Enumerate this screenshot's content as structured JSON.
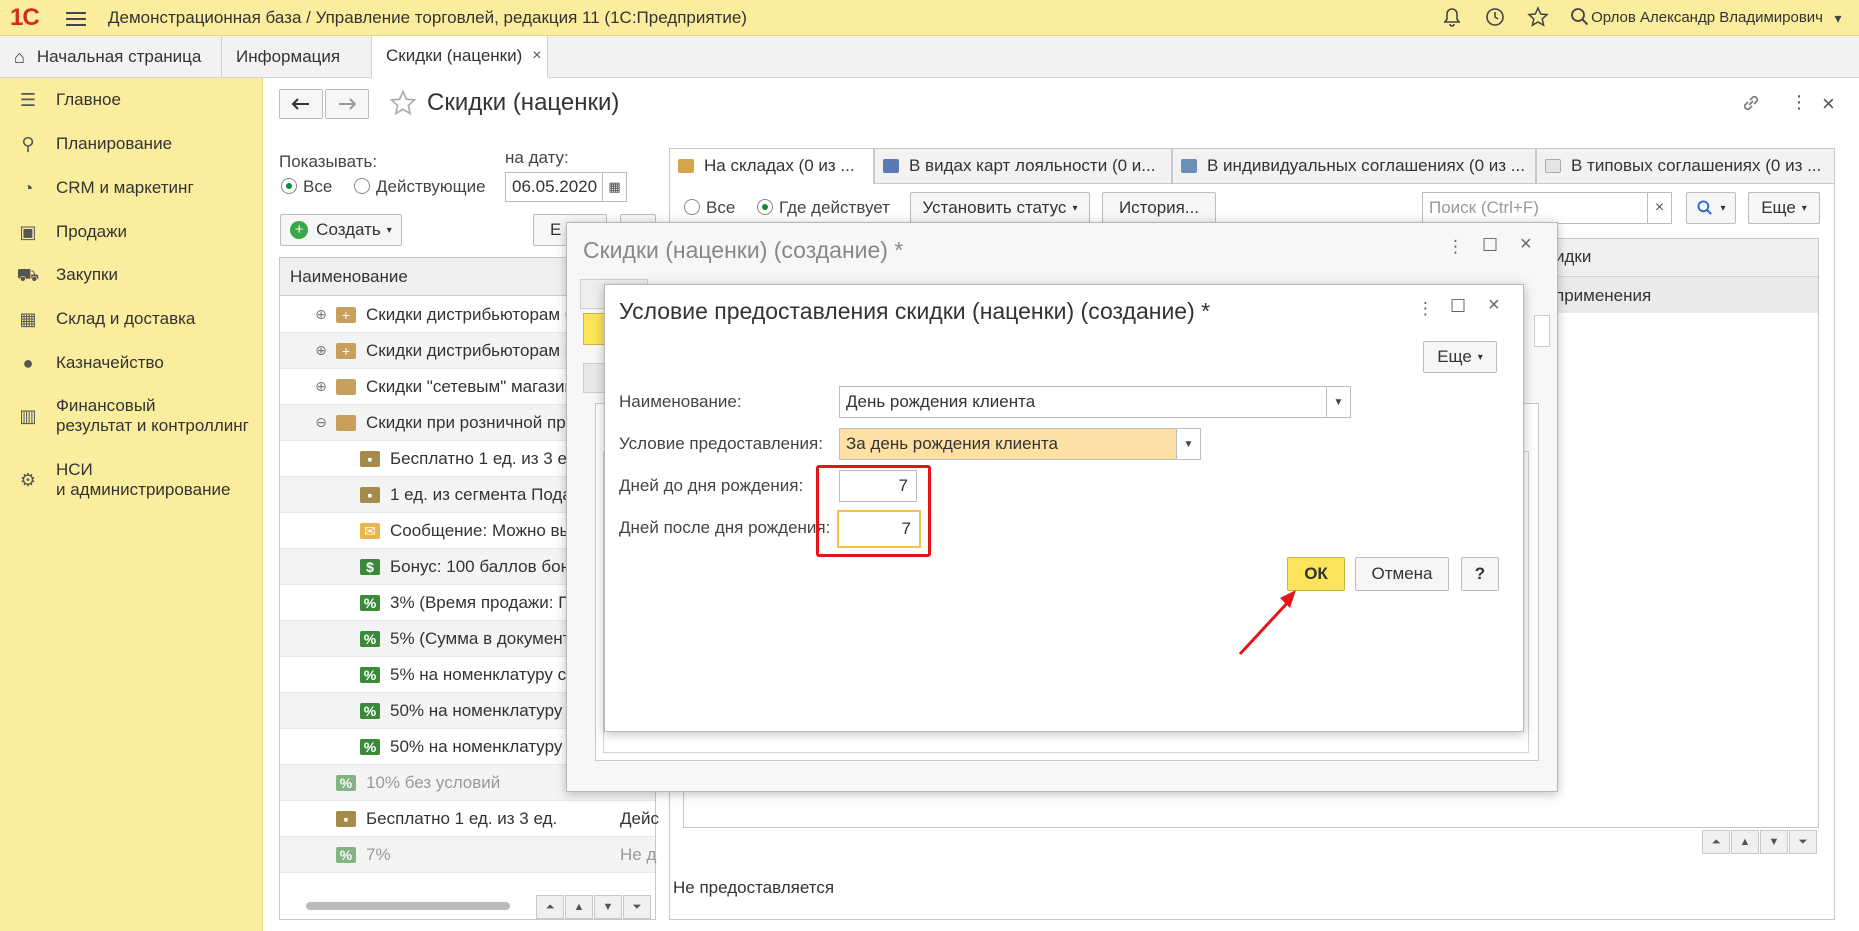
{
  "app": {
    "logo": "1С",
    "title": "Демонстрационная база / Управление торговлей, редакция 11   (1С:Предприятие)",
    "user": "Орлов Александр Владимирович"
  },
  "page_tabs": [
    {
      "label": "Начальная страница"
    },
    {
      "label": "Информация"
    },
    {
      "label": "Скидки (наценки)",
      "close": "×"
    }
  ],
  "sidebar": {
    "items": [
      {
        "label": "Главное"
      },
      {
        "label": "Планирование"
      },
      {
        "label": "CRM и маркетинг"
      },
      {
        "label": "Продажи"
      },
      {
        "label": "Закупки"
      },
      {
        "label": "Склад и доставка"
      },
      {
        "label": "Казначейство"
      },
      {
        "label": "Финансовый",
        "label2": "результат и контроллинг"
      },
      {
        "label": "НСИ",
        "label2": "и администрирование"
      }
    ]
  },
  "form": {
    "title": "Скидки (наценки)",
    "show_label": "Показывать:",
    "radio_all": "Все",
    "radio_active": "Действующие",
    "date_label": "на дату:",
    "date_value": "06.05.2020",
    "create_button": "Создать",
    "more_button_partial": "Е",
    "tree_header": "Наименование",
    "tree_rows": [
      {
        "label": "Скидки дистрибьюторам б",
        "exp": "⊕"
      },
      {
        "label": "Скидки дистрибьюторам м",
        "exp": "⊕"
      },
      {
        "label": "Скидки \"сетевым\" магазин",
        "exp": "⊕"
      },
      {
        "label": "Скидки при розничной про",
        "exp": "⊖"
      },
      {
        "label": "Бесплатно 1 ед. из 3 ед"
      },
      {
        "label": "1 ед. из сегмента Пода"
      },
      {
        "label": "Сообщение: Можно вы"
      },
      {
        "label": "Бонус: 100 баллов бон"
      },
      {
        "label": "3% (Время продажи: П"
      },
      {
        "label": "5% (Сумма в документ"
      },
      {
        "label": "5% на номенклатуру се"
      },
      {
        "label": "50% на номенклатуру"
      },
      {
        "label": "50% на номенклатуру"
      },
      {
        "label": "10% без условий"
      },
      {
        "label": "Бесплатно 1 ед. из 3 ед.",
        "status": "Дейс"
      },
      {
        "label": "7%",
        "status": "Не д"
      }
    ],
    "right_tabs": [
      {
        "label": "На складах (0 из ..."
      },
      {
        "label": "В видах карт лояльности (0 и..."
      },
      {
        "label": "В индивидуальных соглашениях (0 из ..."
      },
      {
        "label": "В типовых соглашениях (0 из ..."
      }
    ],
    "right_radio_all": "Все",
    "right_radio_where": "Где действует",
    "set_status_button": "Установить статус",
    "history_button": "История...",
    "search_placeholder": "Поиск (Ctrl+F)",
    "search_clear": "×",
    "more_button": "Еще",
    "right_col_partial": "идки",
    "right_row_partial": "применения",
    "footer_status": "Не предоставляется"
  },
  "dialog1": {
    "title": "Скидки (наценки) (создание) *"
  },
  "dialog2": {
    "title": "Условие предоставления скидки (наценки) (создание) *",
    "more_button": "Еще",
    "name_label": "Наименование:",
    "name_value": "День рождения клиента",
    "condition_label": "Условие предоставления:",
    "condition_value": "За день рождения клиента",
    "days_before_label": "Дней до дня рождения:",
    "days_before_value": "7",
    "days_after_label": "Дней после дня рождения:",
    "days_after_value": "7",
    "ok_button": "ОК",
    "cancel_button": "Отмена",
    "help_button": "?"
  }
}
